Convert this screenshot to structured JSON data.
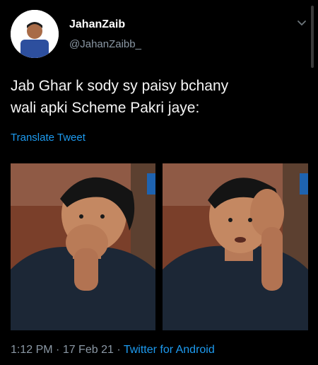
{
  "user": {
    "display_name": "JahanZaib",
    "handle": "@JahanZaibb_",
    "avatar_icon": "profile-photo"
  },
  "tweet": {
    "text": "Jab Ghar k sody sy paisy bchany\nwali apki Scheme Pakri jaye:",
    "translate_label": "Translate Tweet",
    "time": "1:12 PM",
    "separator": " · ",
    "date": "17 Feb 21",
    "source": "Twitter for Android"
  },
  "media": {
    "left_description": "man covering mouth with hand",
    "right_description": "man holding forehead with hand"
  },
  "colors": {
    "background": "#000000",
    "link": "#1d9bf0",
    "secondary_text": "#8b98a5"
  },
  "icons": {
    "menu": "chevron-down-icon"
  }
}
